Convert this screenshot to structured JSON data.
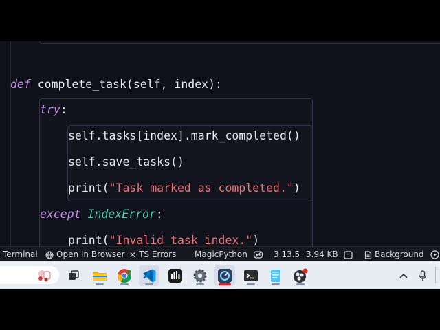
{
  "editor": {
    "lines": {
      "def_kw": "def",
      "def_name": "complete_task",
      "def_params": "(self, index):",
      "try_kw": "try",
      "try_colon": ":",
      "l1": "self.tasks[index].mark_completed()",
      "l2": "self.save_tasks()",
      "l3_fn": "print(",
      "l3_str": "\"Task marked as completed.\"",
      "l3_end": ")",
      "except_kw": "except",
      "except_cls": "IndexError",
      "except_colon": ":",
      "l4_fn": "print(",
      "l4_str": "\"Invalid task index.\"",
      "l4_end": ")"
    }
  },
  "statusbar": {
    "terminal": "Terminal",
    "open_browser": "Open In Browser",
    "ts_errors": "TS Errors",
    "language": "MagicPython",
    "python_version": "3.13.5",
    "file_size": "3.94 KB",
    "background": "Background"
  },
  "taskbar": {
    "apps": [
      "file-explorer",
      "chrome",
      "vscode",
      "audio-app",
      "settings",
      "monitor-app",
      "terminal",
      "notepad",
      "obs"
    ]
  },
  "colors": {
    "editor_bg": "#0f111a",
    "keyword": "#c792ea",
    "class_name": "#4ec9b0",
    "string": "#f07178",
    "taskbar_bg": "#e8ecf3"
  }
}
